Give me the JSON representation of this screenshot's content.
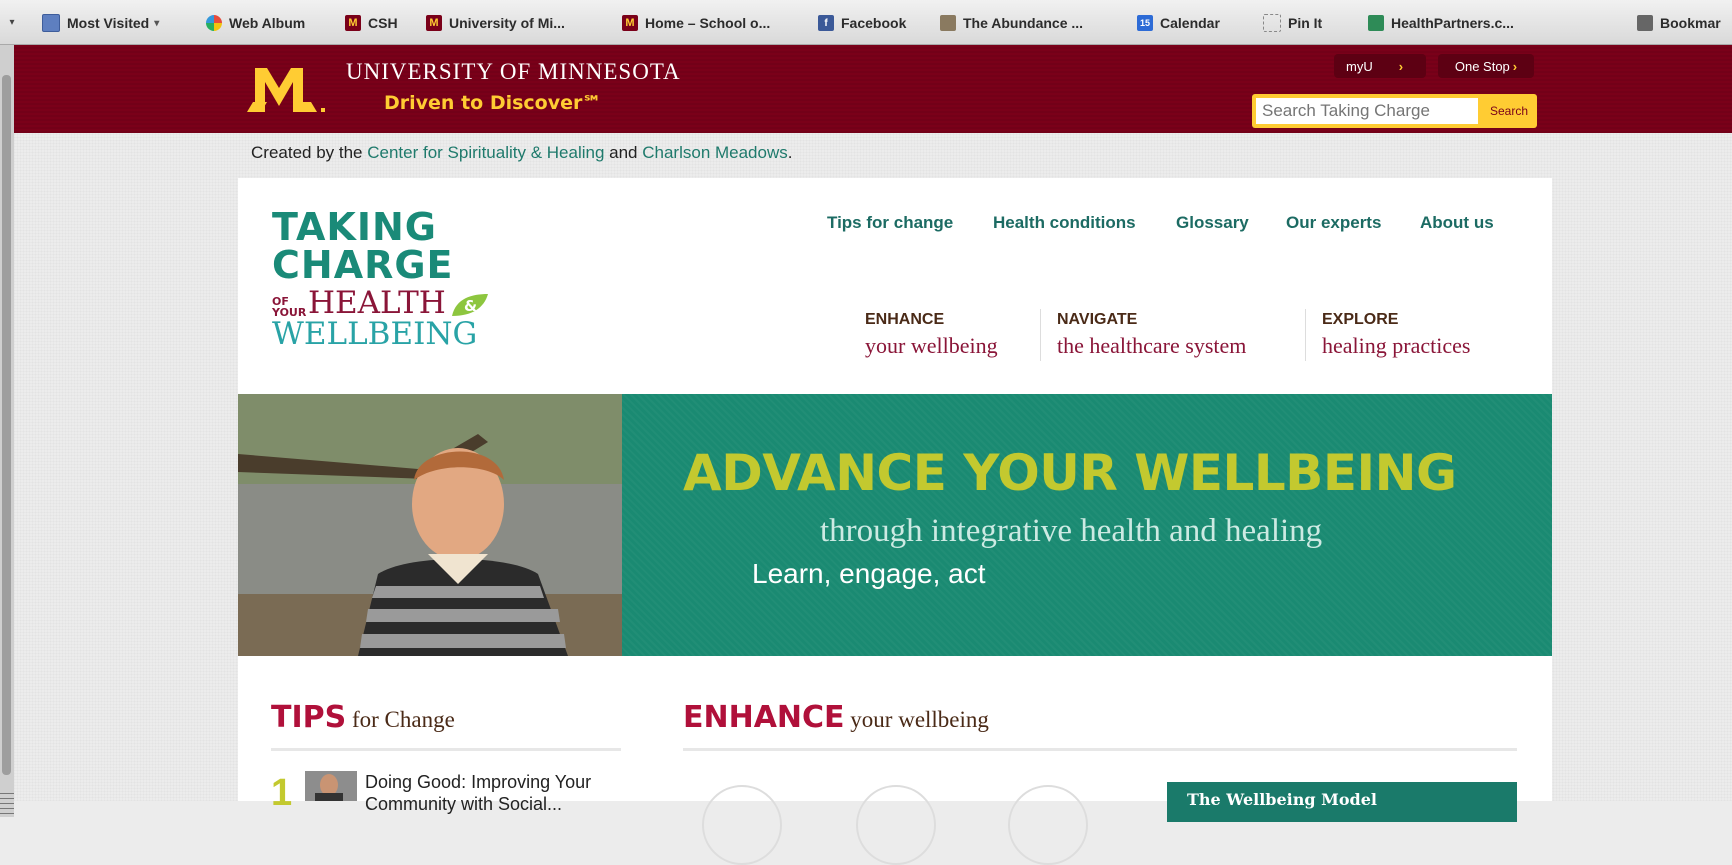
{
  "bookmarks": [
    {
      "label": "Most Visited",
      "icon": "bookmark-folder-icon",
      "caret": "▾"
    },
    {
      "label": "Web Album",
      "icon": "picasa-icon"
    },
    {
      "label": "CSH",
      "icon": "umn-m-icon"
    },
    {
      "label": "University of Mi...",
      "icon": "umn-m-icon"
    },
    {
      "label": "Home – School o...",
      "icon": "umn-m-icon"
    },
    {
      "label": "Facebook",
      "icon": "facebook-icon"
    },
    {
      "label": "The Abundance ...",
      "icon": "abundance-icon"
    },
    {
      "label": "Calendar",
      "icon": "calendar-icon",
      "icon_text": "15"
    },
    {
      "label": "Pin It",
      "icon": "pin-it-icon"
    },
    {
      "label": "HealthPartners.c...",
      "icon": "healthpartners-icon"
    },
    {
      "label": "Bookmar",
      "icon": "bookmarks-icon"
    }
  ],
  "umn": {
    "name": "UNIVERSITY OF MINNESOTA",
    "tagline": "Driven to Discover℠",
    "myu_label": "myU",
    "myu_chevron": "›",
    "onestop_label": "One Stop",
    "onestop_chevron": "›",
    "search_placeholder": "Search Taking Charge",
    "search_button": "Search"
  },
  "credit": {
    "prefix": "Created by the ",
    "link1": "Center for Spirituality & Healing",
    "middle": " and ",
    "link2": "Charlson Meadows",
    "suffix": "."
  },
  "logo": {
    "line1": "TAKING",
    "line2": "CHARGE",
    "of": "OF",
    "your": "YOUR",
    "health": "HEALTH",
    "amp": "&",
    "wellbeing": "WELLBEING"
  },
  "nav": [
    {
      "label": "Tips for change"
    },
    {
      "label": "Health conditions"
    },
    {
      "label": "Glossary"
    },
    {
      "label": "Our experts"
    },
    {
      "label": "About us"
    }
  ],
  "sections": [
    {
      "label": "ENHANCE",
      "sub": "your wellbeing"
    },
    {
      "label": "NAVIGATE",
      "sub": "the healthcare system"
    },
    {
      "label": "EXPLORE",
      "sub": "healing practices"
    }
  ],
  "hero": {
    "title": "ADVANCE YOUR WELLBEING",
    "subtitle": "through integrative health and healing",
    "cta": "Learn, engage, act"
  },
  "tips": {
    "head_big": "TIPS",
    "head_small": " for Change",
    "item1_num": "1",
    "item1_text": "Doing Good: Improving Your Community with Social..."
  },
  "enhance": {
    "head_big": "ENHANCE",
    "head_small": " your wellbeing",
    "model_label": "The Wellbeing Model"
  },
  "colors": {
    "maroon": "#7a0019",
    "gold": "#ffcc33",
    "teal": "#1a8a72",
    "crimson": "#b0103a",
    "lime": "#c3c92f"
  }
}
